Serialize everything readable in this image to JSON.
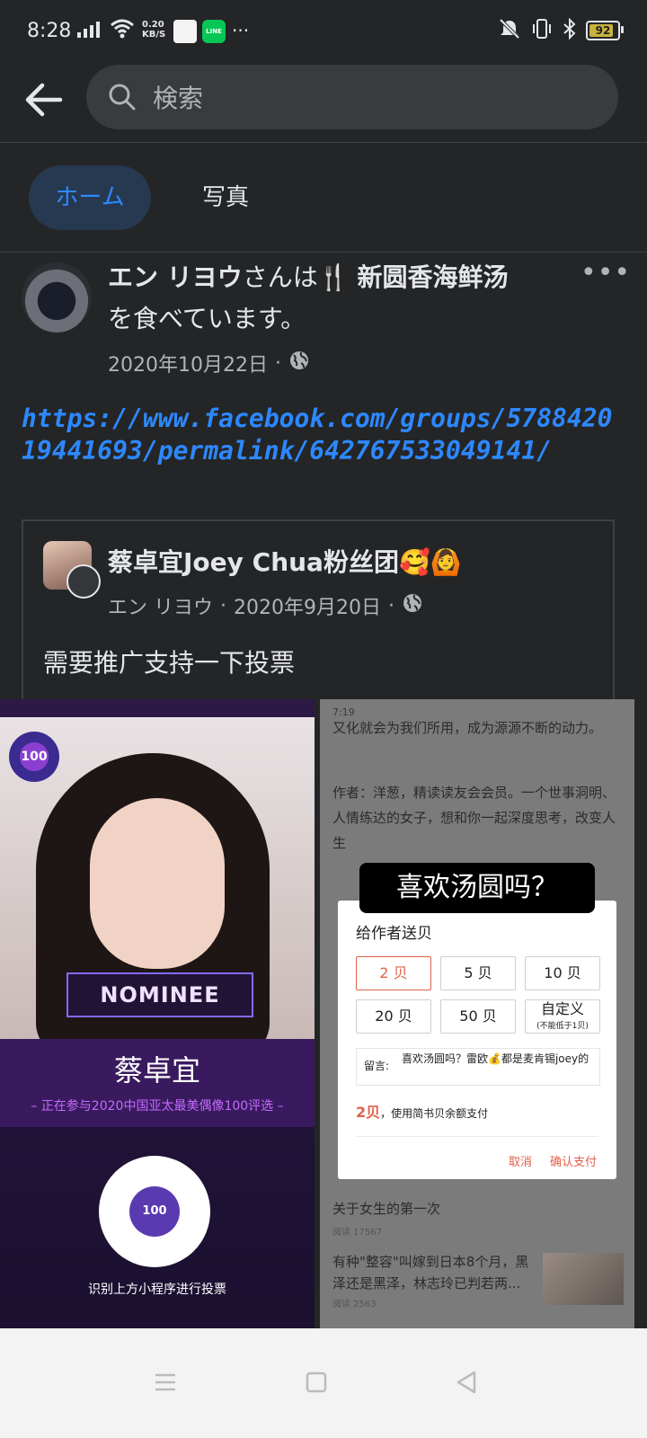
{
  "status_bar": {
    "time": "8:28",
    "speed_top": "0.20",
    "speed_bottom": "KB/S",
    "more": "···",
    "battery": "92",
    "line_app": "LINE"
  },
  "search": {
    "placeholder": "検索"
  },
  "tabs": [
    {
      "label": "ホーム"
    },
    {
      "label": "写真"
    }
  ],
  "post": {
    "author": "エン リヨウ",
    "verb_pre": "さんは",
    "place": "新圆香海鲜汤",
    "verb_post": "を食べています。",
    "date": "2020年10月22日",
    "dot": "·",
    "link": "https://www.facebook.com/groups/578842019441693/permalink/642767533049141/",
    "shared": {
      "group_name": "蔡卓宜Joey Chua粉丝团🥰🙆",
      "author": "エン リヨウ",
      "date": "2020年9月20日",
      "body": "需要推广支持一下投票"
    }
  },
  "image_left": {
    "badge": "100",
    "nominee": "NOMINEE",
    "name": "蔡卓宜",
    "subtitle": "– 正在参与2020中国亚太最美偶像100评选 –",
    "qr_center": "100",
    "caption": "识别上方小程序进行投票"
  },
  "image_right": {
    "status_time": "7:19",
    "text1": "又化就会为我们所用，成为源源不断的动力。",
    "text2": "作者：洋葱，精读读友会会员。一个世事洞明、人情练达的女子，想和你一起深度思考，改变人生",
    "bubble": "喜欢汤圆吗？",
    "dialog_title": "给作者送贝",
    "options": [
      "2 贝",
      "5 贝",
      "10 贝",
      "20 贝",
      "50 贝",
      "自定义"
    ],
    "custom_hint": "(不能低于1贝)",
    "message_label": "留言:",
    "message_value": "喜欢汤圆吗？雷欧💰都是麦肯锡joey的",
    "pay_amount": "2贝",
    "pay_text": "，使用简书贝余额支付",
    "cancel": "取消",
    "confirm": "确认支付",
    "list": [
      {
        "title": "关于女生的第一次",
        "reads": "阅读 17567"
      },
      {
        "title": "有种\"整容\"叫嫁到日本8个月，黑泽还是黑泽，林志玲已判若两...",
        "reads": "阅读 2563"
      }
    ]
  }
}
